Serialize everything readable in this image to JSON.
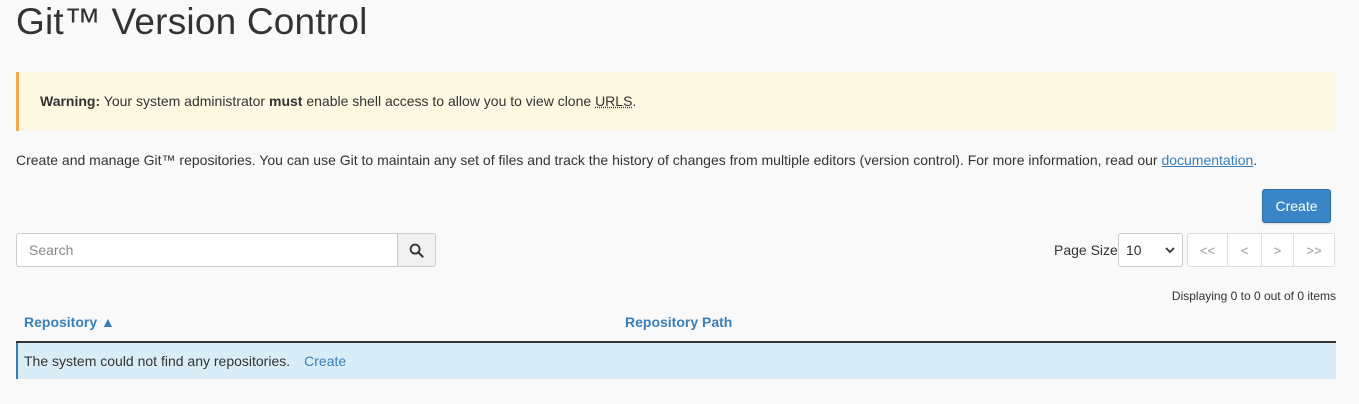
{
  "header": {
    "title": "Git™ Version Control"
  },
  "warning": {
    "label": "Warning:",
    "text_before": " Your system administrator ",
    "emphasis": "must",
    "text_middle": " enable shell access to allow you to view clone ",
    "abbr": "URLS",
    "text_after": "."
  },
  "intro": {
    "text": "Create and manage Git™ repositories. You can use Git to maintain any set of files and track the history of changes from multiple editors (version control). For more information, read our ",
    "link": "documentation",
    "end": "."
  },
  "toolbar": {
    "create_label": "Create",
    "search_placeholder": "Search",
    "search_icon": "search-icon",
    "page_size_label": "Page Size",
    "page_size_value": "10",
    "pager": {
      "first": "<<",
      "prev": "<",
      "next": ">",
      "last": ">>"
    },
    "displaying": "Displaying 0 to 0 out of 0 items"
  },
  "table": {
    "columns": [
      "Repository ▲",
      "Repository Path"
    ],
    "empty_message": "The system could not find any repositories.",
    "empty_link": "Create"
  },
  "colors": {
    "primary": "#3a85c6",
    "link": "#3a7eb8",
    "warning_bg": "#fcf8e1",
    "warning_border": "#f0ad4e",
    "info_row_bg": "#d9edf8"
  }
}
